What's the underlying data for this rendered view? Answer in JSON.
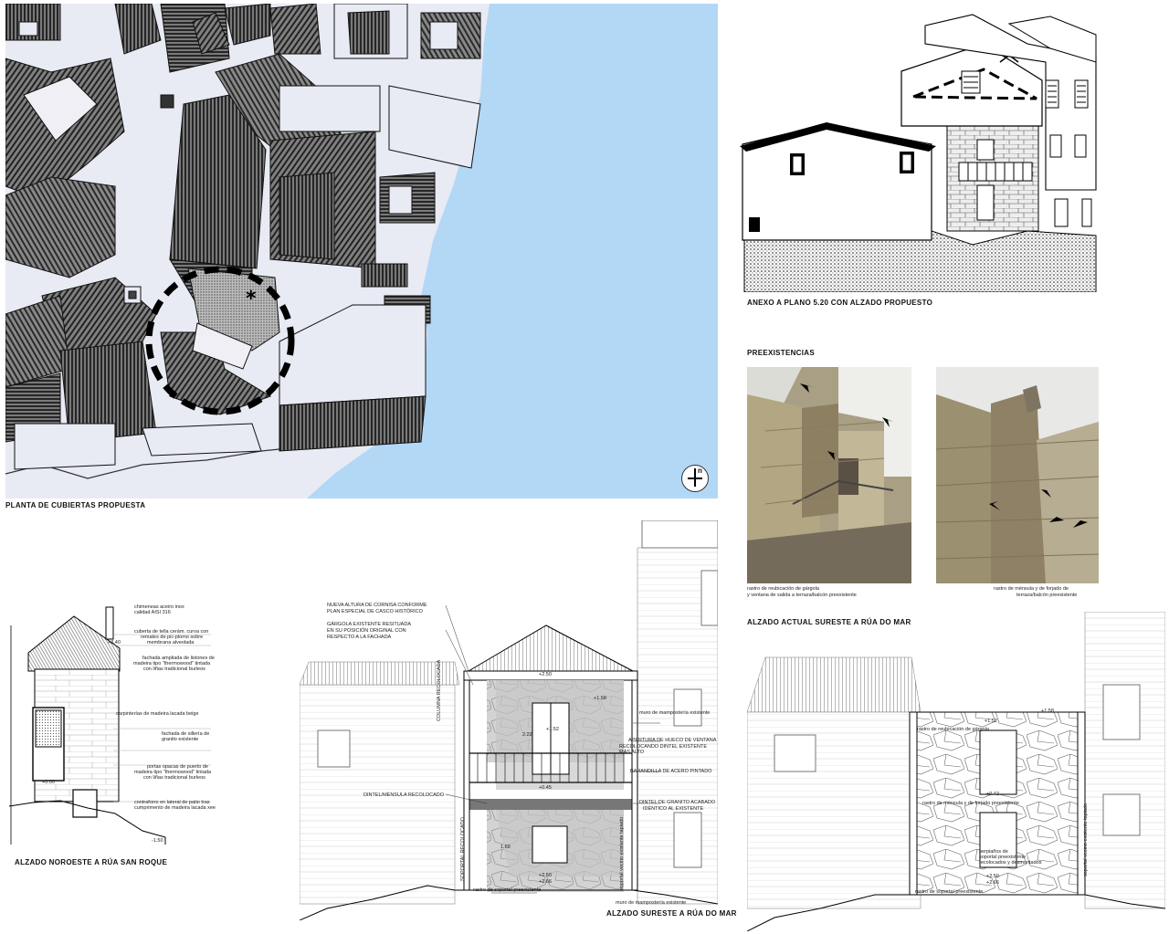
{
  "site_plan": {
    "caption": "PLANTA DE CUBIERTAS PROPUESTA",
    "north_label": "n"
  },
  "sketch": {
    "caption": "ANEXO A PLANO 5.20 CON ALZADO PROPUESTO"
  },
  "preexistencias": {
    "caption": "PREEXISTENCIAS",
    "photo_left_note_1": "rastro de reubicación de gárgola",
    "photo_left_note_2": "y ventana de salida a terraza/balcón preexistente",
    "photo_right_note_1": "rastro de ménsula y de forjado de",
    "photo_right_note_2": "terraza/balcón preexistente"
  },
  "elev_nw": {
    "caption": "ALZADO NOROESTE A RÚA SAN ROQUE",
    "notes": [
      "chimeneas aceiro inox",
      "calidad AISI 316",
      "cuberta de tella cerám. curva con",
      "remates de pic-plomo sobre",
      "membrana alveolada",
      "fachada ampliada de listones de",
      "madeira tipo \"thermowood\" tintada",
      "con liñas tradicional burleos",
      "carpinterías de madeira lacada beige",
      "fachada de sillería de",
      "granito existente",
      "portas opacas de puerto de",
      "madeira tipo \"thermowood\" tintada",
      "con liñas tradicional burleos",
      "contraforro en lateral de patio tras",
      "cumprimento de madeira lacada xee"
    ],
    "levels": [
      "+3.40",
      "+0.00",
      "-1.50"
    ]
  },
  "elev_se_prop": {
    "caption": "ALZADO SURESTE A RÚA DO MAR",
    "notes": [
      "NUEVA ALTURA DE CORNISA CONFORME",
      "PLAN ESPECIAL DE CASCO HISTÓRICO",
      "GÁRGOLA EXISTENTE RESITUADA",
      "EN SU POSICIÓN ORIGINAL CON",
      "RESPECTO A LA FACHADA"
    ],
    "right_notes": [
      "muro de mampostería existente",
      "APERTURA DE HUECO DE VENTANA",
      "RECOLOCANDO DINTEL EXISTENTE MÁS ALTO",
      "BARANDILLA DE ACERO PINTADO",
      "DINTEL DE GRANITO ACABADO",
      "IDÉNTICO AL EXISTENTE",
      "muro de mampostería existente"
    ],
    "left_notes": [
      "DINTEL/MÉNSULA RECOLOCADO",
      "rastro de soportal preexistente"
    ],
    "vertical_notes": [
      "COLUMNA RECOLOCADA",
      "SOPORTAL RECOLOCADO",
      "soportal vecino existente tapiado"
    ],
    "levels": [
      "+2.50",
      "+1.58",
      "+1.52",
      "+0.45",
      "+2.50",
      "+2.66",
      "1.69",
      "2.22"
    ]
  },
  "elev_se_actual": {
    "caption": "ALZADO ACTUAL SURESTE A RÚA DO MAR",
    "notes": [
      "rastro de reubicación de gárgola",
      "rastro de ménsula y de forjado preexistente",
      "perpiaños de",
      "soportal preexistente",
      "recolocados y desmontados",
      "rastro de soportal preexistente"
    ],
    "vertical_notes": [
      "soportal vecino existente tapiado"
    ],
    "levels": [
      "+1.52",
      "+1.58",
      "+0.42",
      "+2.50",
      "+2.66"
    ]
  },
  "colors": {
    "sea": "#b3d8f6",
    "plan_bg": "#e8eaf4",
    "roof_dark": "#3c3c3c",
    "stone_light": "#c2bca8"
  }
}
